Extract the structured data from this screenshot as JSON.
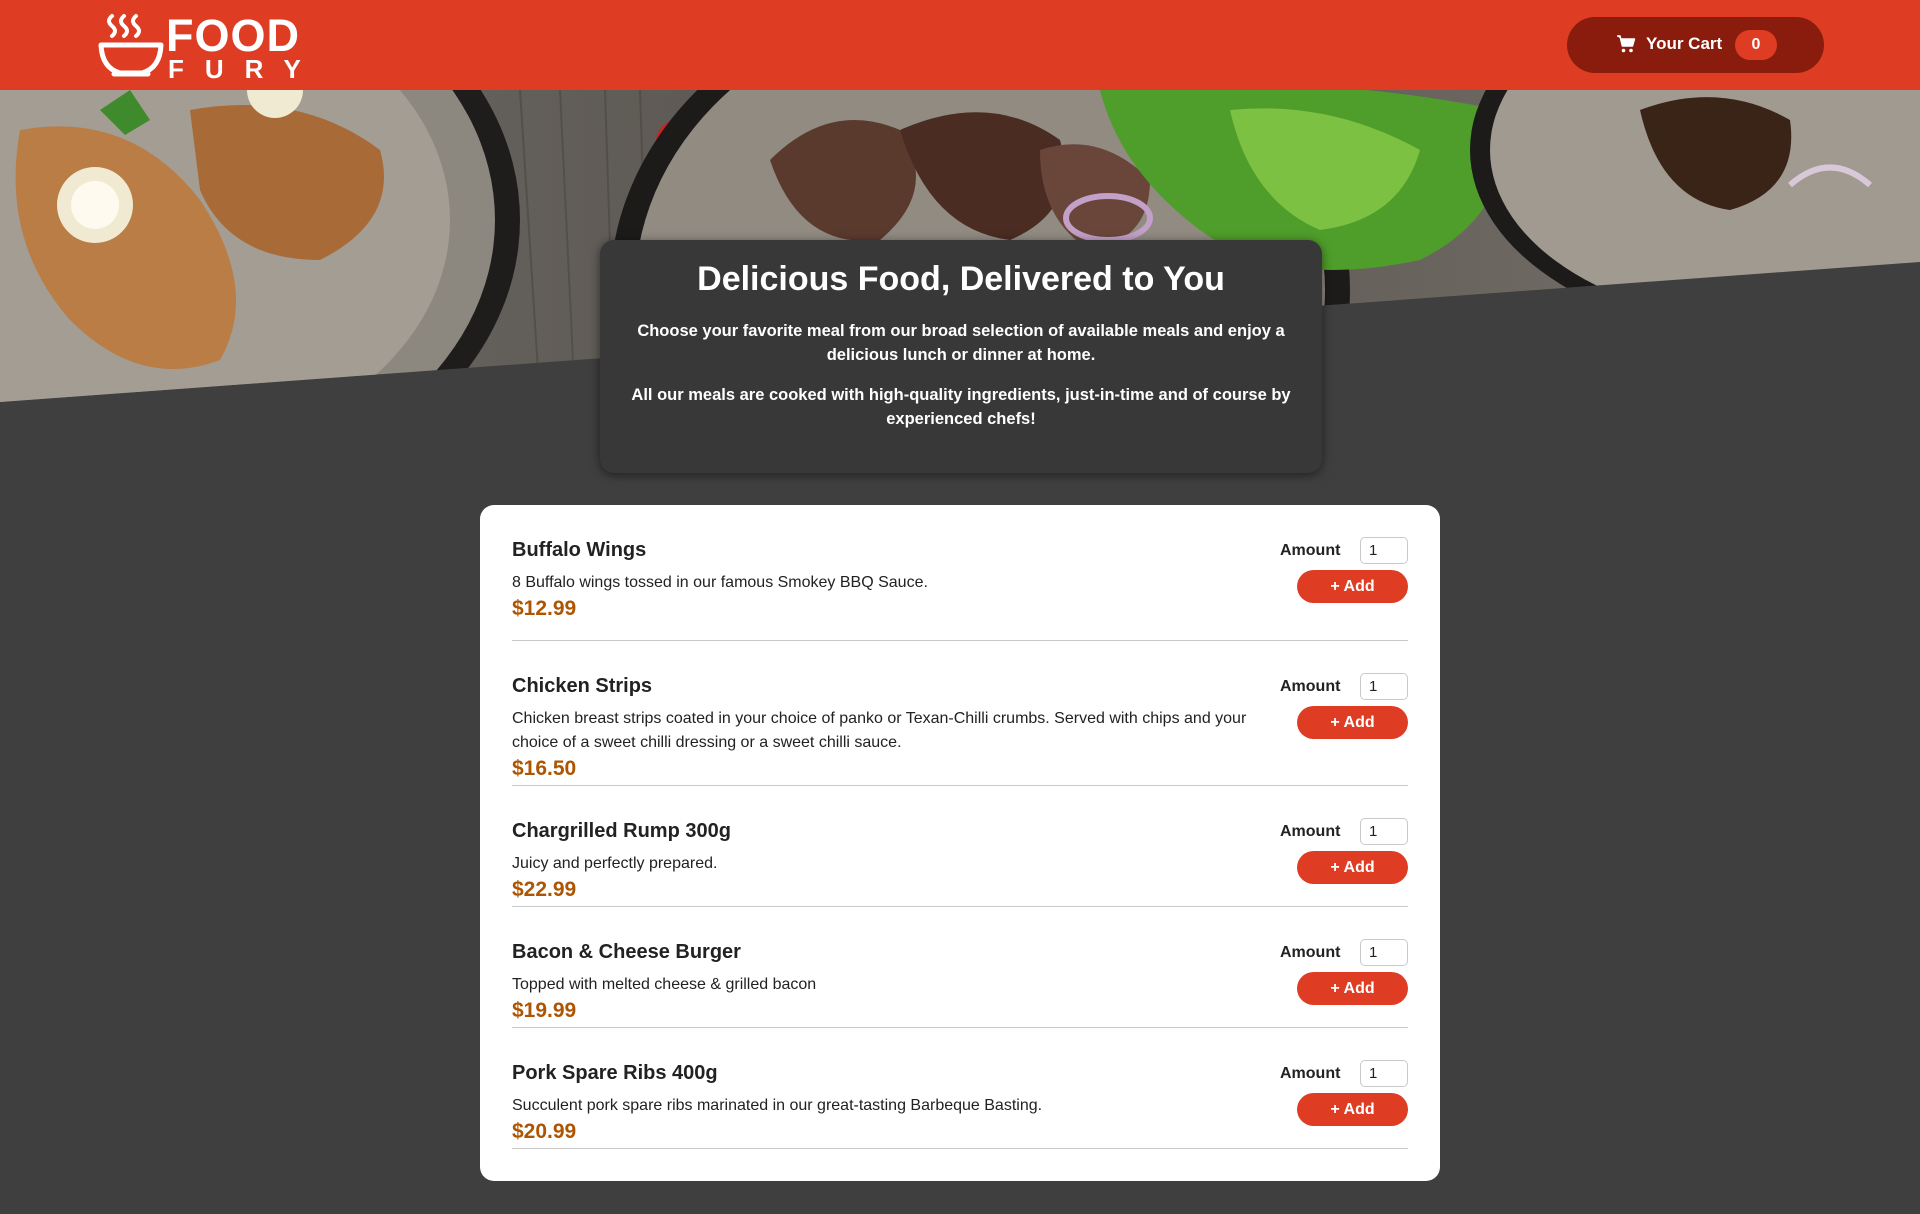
{
  "header": {
    "logo_line1": "FOOD",
    "logo_line2": "FURY",
    "cart": {
      "label": "Your Cart",
      "count": "0"
    }
  },
  "intro": {
    "title": "Delicious Food, Delivered to You",
    "paragraph1": "Choose your favorite meal from our broad selection of available meals and enjoy a delicious lunch or dinner at home.",
    "paragraph2": "All our meals are cooked with high-quality ingredients, just-in-time and of course by experienced chefs!"
  },
  "meals": [
    {
      "name": "Buffalo Wings",
      "description": "8 Buffalo wings tossed in our famous Smokey BBQ Sauce.",
      "price": "$12.99",
      "amount_label": "Amount",
      "amount": "1",
      "add_label": "+ Add"
    },
    {
      "name": "Chicken Strips",
      "description": "Chicken breast strips coated in your choice of panko or Texan-Chilli crumbs. Served with chips and your choice of a sweet chilli dressing or a sweet chilli sauce.",
      "price": "$16.50",
      "amount_label": "Amount",
      "amount": "1",
      "add_label": "+ Add"
    },
    {
      "name": "Chargrilled Rump 300g",
      "description": "Juicy and perfectly prepared.",
      "price": "$22.99",
      "amount_label": "Amount",
      "amount": "1",
      "add_label": "+ Add"
    },
    {
      "name": "Bacon & Cheese Burger",
      "description": "Topped with melted cheese & grilled bacon",
      "price": "$19.99",
      "amount_label": "Amount",
      "amount": "1",
      "add_label": "+ Add"
    },
    {
      "name": "Pork Spare Ribs 400g",
      "description": "Succulent pork spare ribs marinated in our great-tasting Barbeque Basting.",
      "price": "$20.99",
      "amount_label": "Amount",
      "amount": "1",
      "add_label": "+ Add"
    }
  ],
  "colors": {
    "brand_red": "#de3d23",
    "cart_dark": "#8a1c0e",
    "price_brown": "#ad5502",
    "page_bg": "#3f3f3f"
  },
  "icons": [
    "soup-bowl-logo-icon",
    "shopping-cart-icon"
  ]
}
